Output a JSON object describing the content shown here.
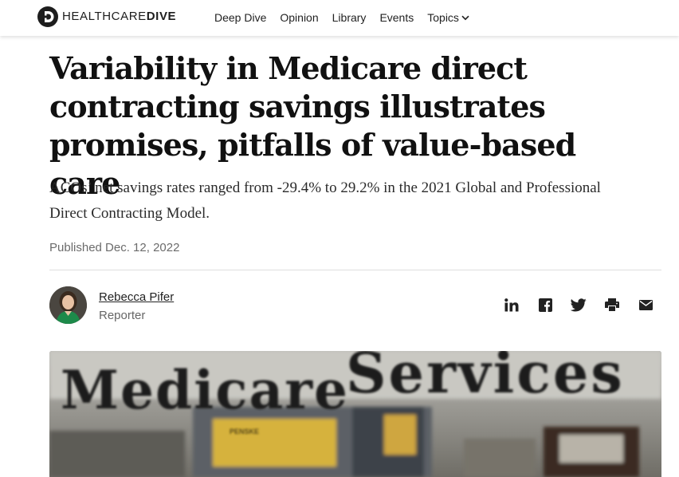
{
  "brand": {
    "name_light": "HEALTHCARE",
    "name_bold": "DIVE",
    "icon": "healthcare-dive-logo-icon"
  },
  "nav": {
    "items": [
      {
        "label": "Deep Dive"
      },
      {
        "label": "Opinion"
      },
      {
        "label": "Library"
      },
      {
        "label": "Events"
      },
      {
        "label": "Topics"
      }
    ],
    "topics_icon": "chevron-down-icon"
  },
  "article": {
    "title": "Variability in Medicare direct contracting savings illustrates promises, pitfalls of value-based care",
    "dek": "ACOs’ net savings rates ranged from -29.4% to 29.2% in the 2021 Global and Professional Direct Contracting Model.",
    "published": "Published Dec. 12, 2022"
  },
  "author": {
    "name": "Rebecca Pifer",
    "role": "Reporter"
  },
  "share": {
    "icons": [
      "linkedin-icon",
      "facebook-icon",
      "twitter-icon",
      "print-icon",
      "email-icon"
    ]
  },
  "hero": {
    "sign_word_1": "Medicare",
    "sign_word_2": "Services",
    "truck_label": "PENSKE"
  },
  "colors": {
    "text": "#111111",
    "muted": "#6b6b6b",
    "divider": "#dedede"
  }
}
